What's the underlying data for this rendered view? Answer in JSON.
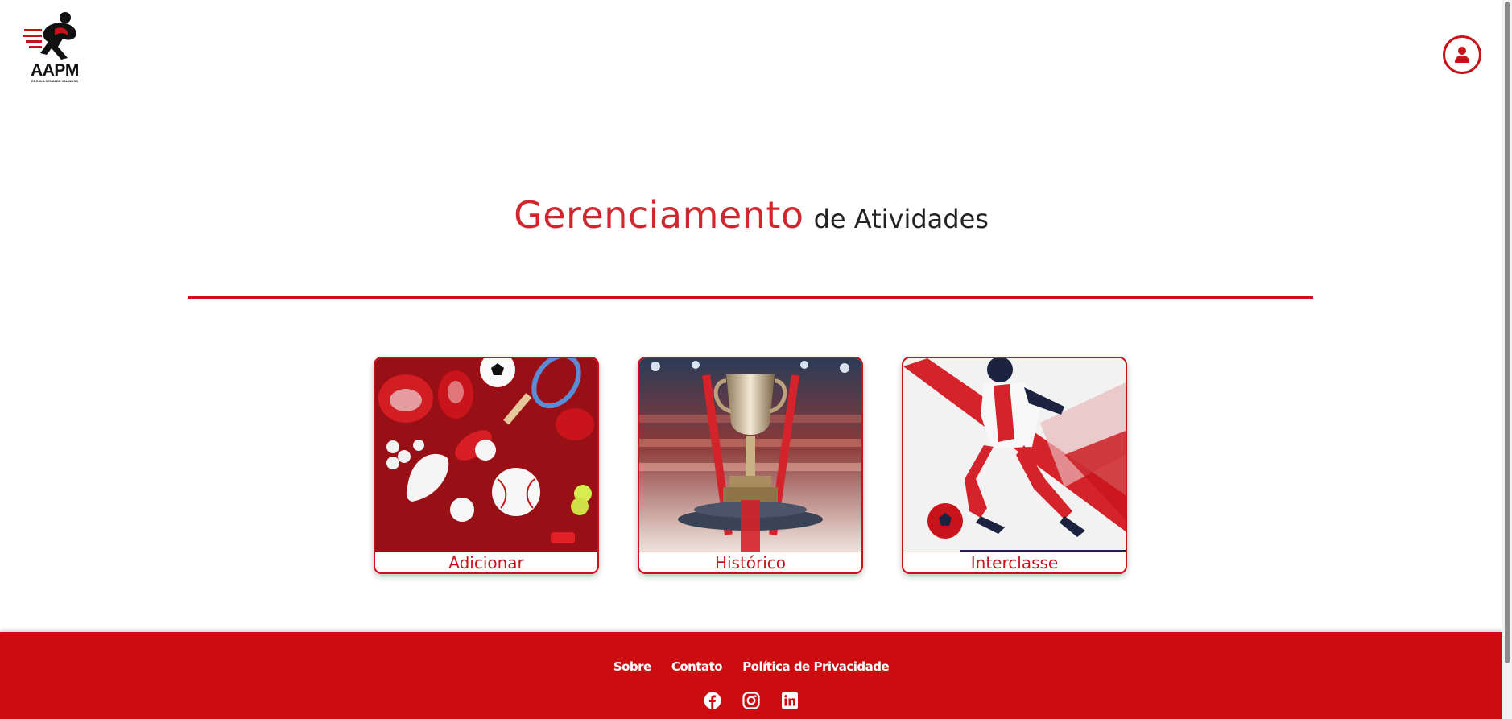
{
  "header": {
    "logo_text": "AAPM",
    "logo_subtext": "ESCOLA SENAI DE VALINHOS",
    "user_icon": "user-icon"
  },
  "title": {
    "main": "Gerenciamento",
    "sub": "de Atividades"
  },
  "cards": [
    {
      "label": "Adicionar",
      "image": "sports-equipment-image"
    },
    {
      "label": "Histórico",
      "image": "trophy-image"
    },
    {
      "label": "Interclasse",
      "image": "soccer-player-image"
    }
  ],
  "footer": {
    "links": [
      "Sobre",
      "Contato",
      "Política de Privacidade"
    ],
    "icons": [
      "facebook-icon",
      "instagram-icon",
      "linkedin-icon"
    ]
  },
  "colors": {
    "accent": "#c8121c",
    "footer_bg": "#cc0c10"
  }
}
